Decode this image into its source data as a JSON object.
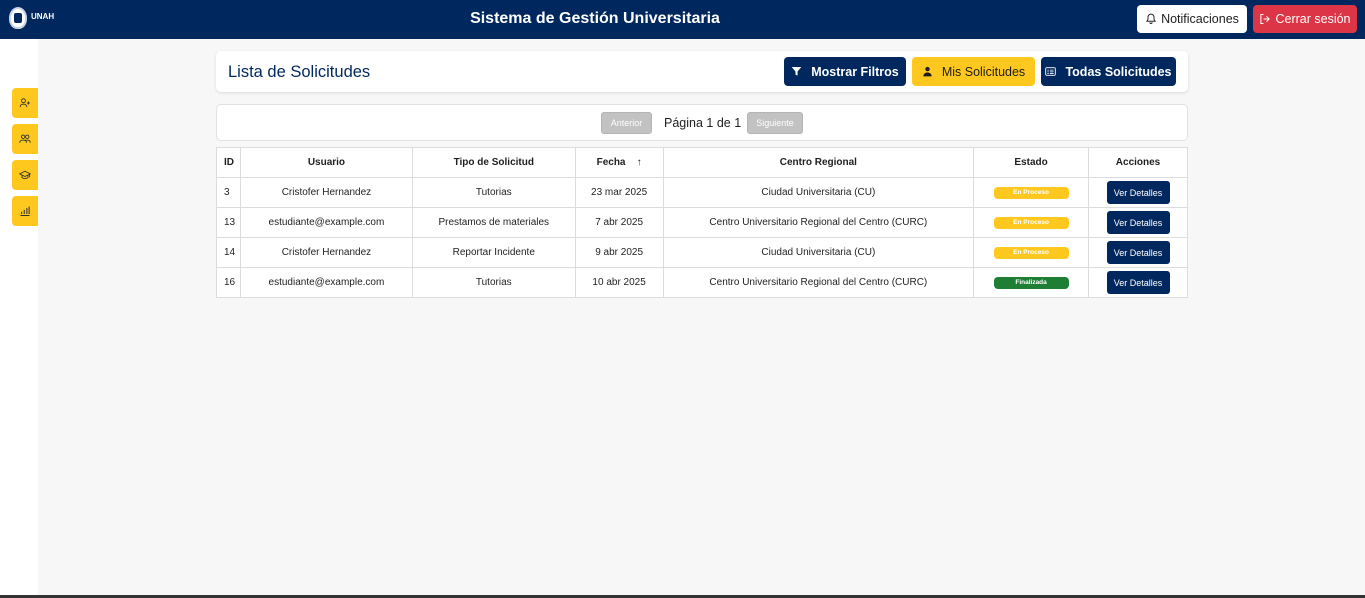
{
  "header": {
    "logo_text": "UNAH",
    "title": "Sistema de Gestión Universitaria",
    "notifications_label": "Notificaciones",
    "logout_label": "Cerrar sesión"
  },
  "sidebar": {
    "items": [
      {
        "icon": "user-plus-icon"
      },
      {
        "icon": "users-icon"
      },
      {
        "icon": "graduation-cap-icon"
      },
      {
        "icon": "bar-chart-icon"
      }
    ]
  },
  "page": {
    "title": "Lista de Solicitudes",
    "btn_filters": "Mostrar Filtros",
    "btn_mine": "Mis Solicitudes",
    "btn_all": "Todas Solicitudes"
  },
  "pagination": {
    "prev": "Anterior",
    "text": "Página 1 de 1",
    "next": "Siguiente"
  },
  "table": {
    "columns": [
      "ID",
      "Usuario",
      "Tipo de Solicitud",
      "Fecha",
      "Centro Regional",
      "Estado",
      "Acciones"
    ],
    "sort_indicator": "↑",
    "rows": [
      {
        "id": "3",
        "usuario": "Cristofer Hernandez",
        "tipo": "Tutorias",
        "fecha": "23 mar 2025",
        "centro": "Ciudad Universitaria (CU)",
        "estado": "En Proceso",
        "accion": "Ver Detalles"
      },
      {
        "id": "13",
        "usuario": "estudiante@example.com",
        "tipo": "Prestamos de materiales",
        "fecha": "7 abr 2025",
        "centro": "Centro Universitario Regional del Centro (CURC)",
        "estado": "En Proceso",
        "accion": "Ver Detalles"
      },
      {
        "id": "14",
        "usuario": "Cristofer Hernandez",
        "tipo": "Reportar Incidente",
        "fecha": "9 abr 2025",
        "centro": "Ciudad Universitaria (CU)",
        "estado": "En Proceso",
        "accion": "Ver Detalles"
      },
      {
        "id": "16",
        "usuario": "estudiante@example.com",
        "tipo": "Tutorias",
        "fecha": "10 abr 2025",
        "centro": "Centro Universitario Regional del Centro (CURC)",
        "estado": "Finalizada",
        "accion": "Ver Detalles"
      }
    ]
  },
  "colors": {
    "navy": "#00285e",
    "gold": "#ffc81e",
    "red": "#dc3545",
    "green": "#1e7e34"
  }
}
